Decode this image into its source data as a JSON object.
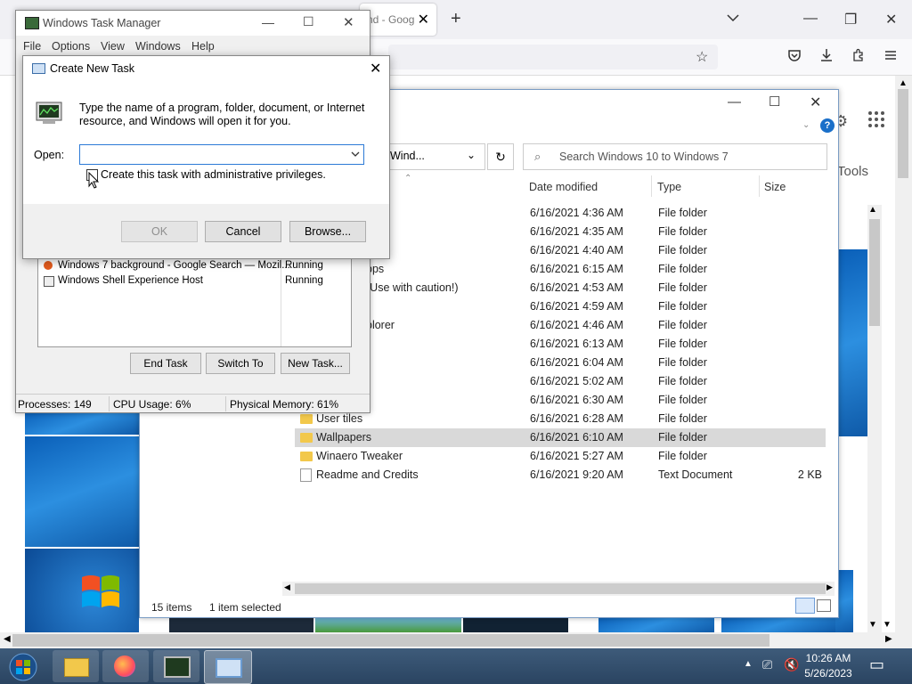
{
  "browser": {
    "tab_title": "nd - Goog",
    "tab_close": "✕",
    "new_tab": "+",
    "tab_list": "⌄",
    "min": "—",
    "restore": "❐",
    "close": "✕",
    "side_text_tools": "Tools"
  },
  "explorer": {
    "address_text": "Wind...",
    "search_placeholder": "Search Windows 10 to Windows 7",
    "columns": {
      "date": "Date modified",
      "type": "Type",
      "size": "Size"
    },
    "rows": [
      {
        "name": "p",
        "date": "6/16/2021 4:36 AM",
        "type": "File folder",
        "size": ""
      },
      {
        "name": "",
        "date": "6/16/2021 4:35 AM",
        "type": "File folder",
        "size": ""
      },
      {
        "name": "",
        "date": "6/16/2021 4:40 AM",
        "type": "File folder",
        "size": ""
      },
      {
        "name": "pps",
        "date": "6/16/2021 6:15 AM",
        "type": "File folder",
        "size": ""
      },
      {
        "name": "(Use with caution!)",
        "date": "6/16/2021 4:53 AM",
        "type": "File folder",
        "size": ""
      },
      {
        "name": "",
        "date": "6/16/2021 4:59 AM",
        "type": "File folder",
        "size": ""
      },
      {
        "name": "plorer",
        "date": "6/16/2021 4:46 AM",
        "type": "File folder",
        "size": ""
      },
      {
        "name": "",
        "date": "6/16/2021 6:13 AM",
        "type": "File folder",
        "size": ""
      },
      {
        "name": "",
        "date": "6/16/2021 6:04 AM",
        "type": "File folder",
        "size": ""
      },
      {
        "name": "",
        "date": "6/16/2021 5:02 AM",
        "type": "File folder",
        "size": ""
      },
      {
        "name": "",
        "date": "6/16/2021 6:30 AM",
        "type": "File folder",
        "size": ""
      },
      {
        "name": "User tiles",
        "date": "6/16/2021 6:28 AM",
        "type": "File folder",
        "size": ""
      },
      {
        "name": "Wallpapers",
        "date": "6/16/2021 6:10 AM",
        "type": "File folder",
        "size": "",
        "selected": true
      },
      {
        "name": "Winaero Tweaker",
        "date": "6/16/2021 5:27 AM",
        "type": "File folder",
        "size": ""
      },
      {
        "name": "Readme and Credits",
        "date": "6/16/2021 9:20 AM",
        "type": "Text Document",
        "size": "2 KB"
      }
    ],
    "status_items": "15 items",
    "status_selected": "1 item selected"
  },
  "taskmgr": {
    "title": "Windows Task Manager",
    "menu": [
      "File",
      "Options",
      "View",
      "Windows",
      "Help"
    ],
    "tasks": [
      {
        "name": "Windows 7 background - Google Search — Mozil...",
        "status": "Running"
      },
      {
        "name": "Windows Shell Experience Host",
        "status": "Running"
      }
    ],
    "buttons": {
      "end": "End Task",
      "switch": "Switch To",
      "new": "New Task..."
    },
    "status": {
      "processes": "Processes: 149",
      "cpu": "CPU Usage: 6%",
      "memory": "Physical Memory: 61%"
    }
  },
  "dialog": {
    "title": "Create New Task",
    "description": "Type the name of a program, folder, document, or Internet resource, and Windows will open it for you.",
    "open_label": "Open:",
    "open_value": "",
    "admin_checkbox": "Create this task with administrative privileges.",
    "ok": "OK",
    "cancel": "Cancel",
    "browse": "Browse..."
  },
  "taskbar": {
    "time": "10:26 AM",
    "date": "5/26/2023"
  }
}
